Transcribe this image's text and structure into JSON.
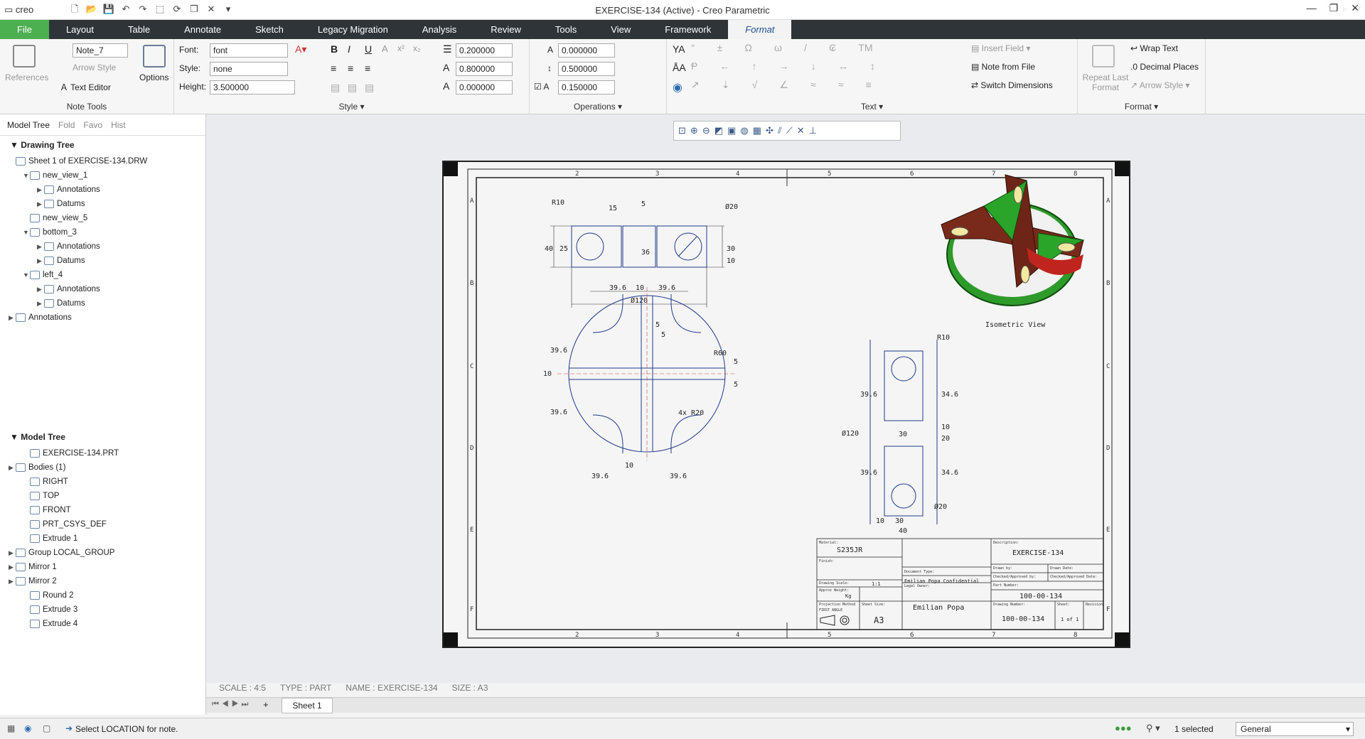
{
  "app": {
    "logo": "creo",
    "window_title": "EXERCISE-134 (Active) - Creo Parametric"
  },
  "menu": {
    "items": [
      "File",
      "Layout",
      "Table",
      "Annotate",
      "Sketch",
      "Legacy Migration",
      "Analysis",
      "Review",
      "Tools",
      "View",
      "Framework",
      "Format"
    ],
    "active": "Format"
  },
  "ribbon": {
    "note_tools": {
      "label": "Note Tools",
      "references": "References",
      "note_name": "Note_7",
      "arrow_style": "Arrow Style",
      "text_editor": "Text Editor",
      "options": "Options"
    },
    "style": {
      "label": "Style",
      "font_label": "Font:",
      "font_value": "font",
      "style_label": "Style:",
      "style_value": "none",
      "height_label": "Height:",
      "height_value": "3.500000",
      "val1": "0.200000",
      "val2": "0.800000",
      "val3": "0.000000"
    },
    "operations": {
      "label": "Operations",
      "v1": "0.000000",
      "v2": "0.500000",
      "v3": "0.150000"
    },
    "text": {
      "label": "Text",
      "insert_field": "Insert Field",
      "note_from_file": "Note from File",
      "switch_dimensions": "Switch Dimensions",
      "tm": "TM"
    },
    "format": {
      "label": "Format",
      "repeat_last_format": "Repeat Last Format",
      "wrap_text": "Wrap Text",
      "decimal_places": "Decimal Places",
      "arrow_style": "Arrow Style"
    }
  },
  "panel": {
    "tabs": [
      "Model Tree",
      "Fold",
      "Favo",
      "Hist"
    ],
    "drawing_tree_title": "Drawing Tree",
    "drawing_tree": [
      {
        "label": "Sheet 1 of EXERCISE-134.DRW",
        "indent": 0,
        "toggle": ""
      },
      {
        "label": "new_view_1",
        "indent": 1,
        "toggle": "▼"
      },
      {
        "label": "Annotations",
        "indent": 2,
        "toggle": "▶"
      },
      {
        "label": "Datums",
        "indent": 2,
        "toggle": "▶"
      },
      {
        "label": "new_view_5",
        "indent": 1,
        "toggle": ""
      },
      {
        "label": "bottom_3",
        "indent": 1,
        "toggle": "▼"
      },
      {
        "label": "Annotations",
        "indent": 2,
        "toggle": "▶"
      },
      {
        "label": "Datums",
        "indent": 2,
        "toggle": "▶"
      },
      {
        "label": "left_4",
        "indent": 1,
        "toggle": "▼"
      },
      {
        "label": "Annotations",
        "indent": 2,
        "toggle": "▶"
      },
      {
        "label": "Datums",
        "indent": 2,
        "toggle": "▶"
      },
      {
        "label": "Annotations",
        "indent": 0,
        "toggle": "▶"
      }
    ],
    "model_tree_title": "Model Tree",
    "model_tree": [
      {
        "label": "EXERCISE-134.PRT",
        "toggle": ""
      },
      {
        "label": "Bodies (1)",
        "toggle": "▶"
      },
      {
        "label": "RIGHT",
        "toggle": ""
      },
      {
        "label": "TOP",
        "toggle": ""
      },
      {
        "label": "FRONT",
        "toggle": ""
      },
      {
        "label": "PRT_CSYS_DEF",
        "toggle": ""
      },
      {
        "label": "Extrude 1",
        "toggle": ""
      },
      {
        "label": "Group LOCAL_GROUP",
        "toggle": "▶"
      },
      {
        "label": "Mirror 1",
        "toggle": "▶"
      },
      {
        "label": "Mirror 2",
        "toggle": "▶"
      },
      {
        "label": "Round 2",
        "toggle": ""
      },
      {
        "label": "Extrude 3",
        "toggle": ""
      },
      {
        "label": "Extrude 4",
        "toggle": ""
      }
    ]
  },
  "drawing": {
    "iso_label": "Isometric View",
    "material_label": "Material:",
    "material": "S235JR",
    "finish_label": "Finish:",
    "description_label": "Description:",
    "description": "EXERCISE-134",
    "drawing_scale_label": "Drawing Scale:",
    "drawing_scale": "1:1",
    "approx_weight_label": "Approx Weight:",
    "approx_weight": "Kg",
    "proj_method_label": "Projection Method",
    "proj_method": "FIRST ANGLE",
    "sheet_size_label": "Sheet Size:",
    "sheet_size": "A3",
    "confidential": "Emilian Popa Confidential",
    "legal_owner_label": "Legal Owner:",
    "legal_owner": "Emilian Popa",
    "part_number_label": "Part Number:",
    "part_number": "100-00-134",
    "drawing_number_label": "Drawing Number:",
    "drawing_number": "100-00-134",
    "sheet_label": "Sheet:",
    "sheet": "1 of 1",
    "revision_label": "Revision:",
    "drawn_by": "Drawn by:",
    "drawn_date": "Drawn Date:",
    "checked_by": "Checked/Approved by:",
    "checked_date": "Checked/Approved Date:",
    "document_type": "Document Type:",
    "dims": [
      "R10",
      "15",
      "5",
      "Ø20",
      "40",
      "25",
      "36",
      "30",
      "10",
      "39.6",
      "10",
      "39.6",
      "Ø120",
      "5",
      "5",
      "R60",
      "39.6",
      "10",
      "39.6",
      "5",
      "5",
      "4x R20",
      "10",
      "39.6",
      "39.6",
      "R10",
      "39.6",
      "34.6",
      "Ø120",
      "30",
      "10",
      "20",
      "39.6",
      "34.6",
      "Ø20",
      "10",
      "30",
      "40"
    ]
  },
  "bottom": {
    "scale": "SCALE : 4:5",
    "type": "TYPE : PART",
    "name": "NAME : EXERCISE-134",
    "size": "SIZE : A3",
    "sheet_tab": "Sheet 1"
  },
  "status": {
    "message": "Select LOCATION for note.",
    "selected": "1 selected",
    "filter": "General"
  },
  "colors": {
    "accent_green": "#4caf50",
    "menubar": "#2f3438",
    "drawing_line": "#1f3a8a",
    "center_line": "#d04040",
    "model_green": "#2e9a2a",
    "model_red": "#c0241e"
  }
}
